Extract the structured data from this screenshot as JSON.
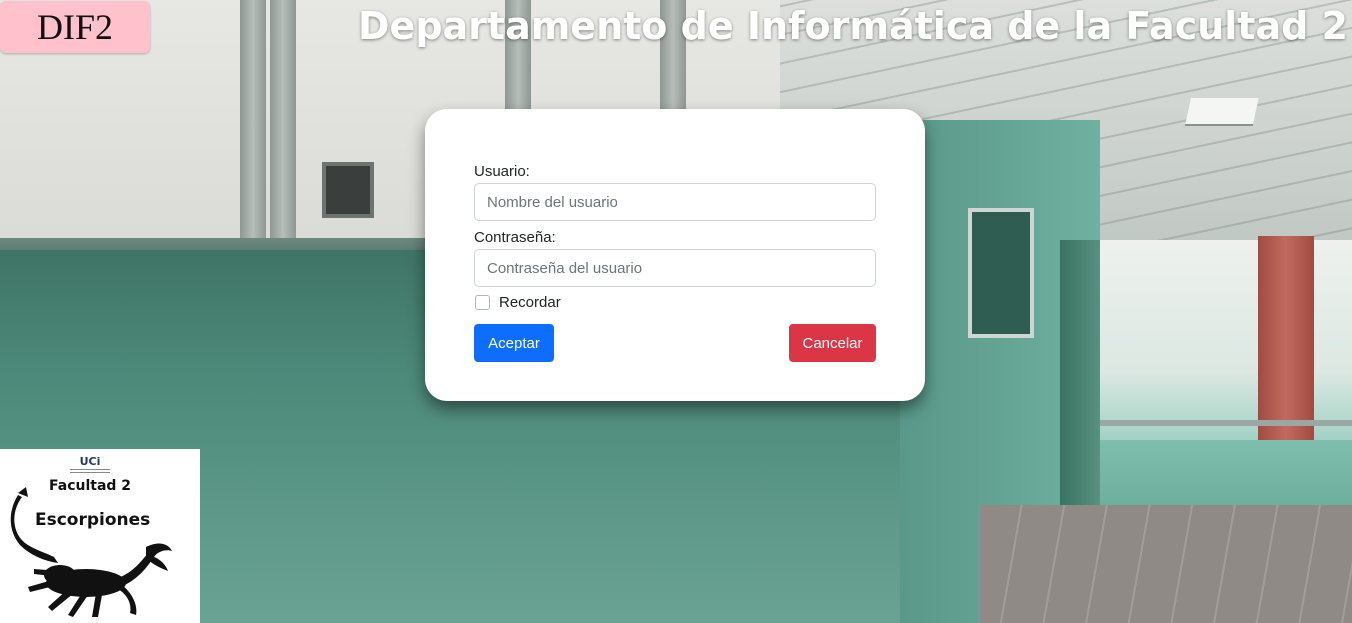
{
  "brand": {
    "badge_text": "DIF2",
    "badge_color": "#ffc1cb"
  },
  "header": {
    "title": "Departamento de Informática de la Facultad 2"
  },
  "login_form": {
    "username_label": "Usuario:",
    "username_value": "",
    "username_placeholder": "Nombre del usuario",
    "password_label": "Contraseña:",
    "password_value": "",
    "password_placeholder": "Contraseña del usuario",
    "remember_label": "Recordar",
    "remember_checked": false,
    "accept_label": "Aceptar",
    "cancel_label": "Cancelar",
    "accept_color": "#0d6efd",
    "cancel_color": "#dc3545"
  },
  "logo": {
    "mark": "UCi",
    "line1": "Facultad 2",
    "line2": "Escorpiones",
    "icon": "scorpion-icon"
  }
}
